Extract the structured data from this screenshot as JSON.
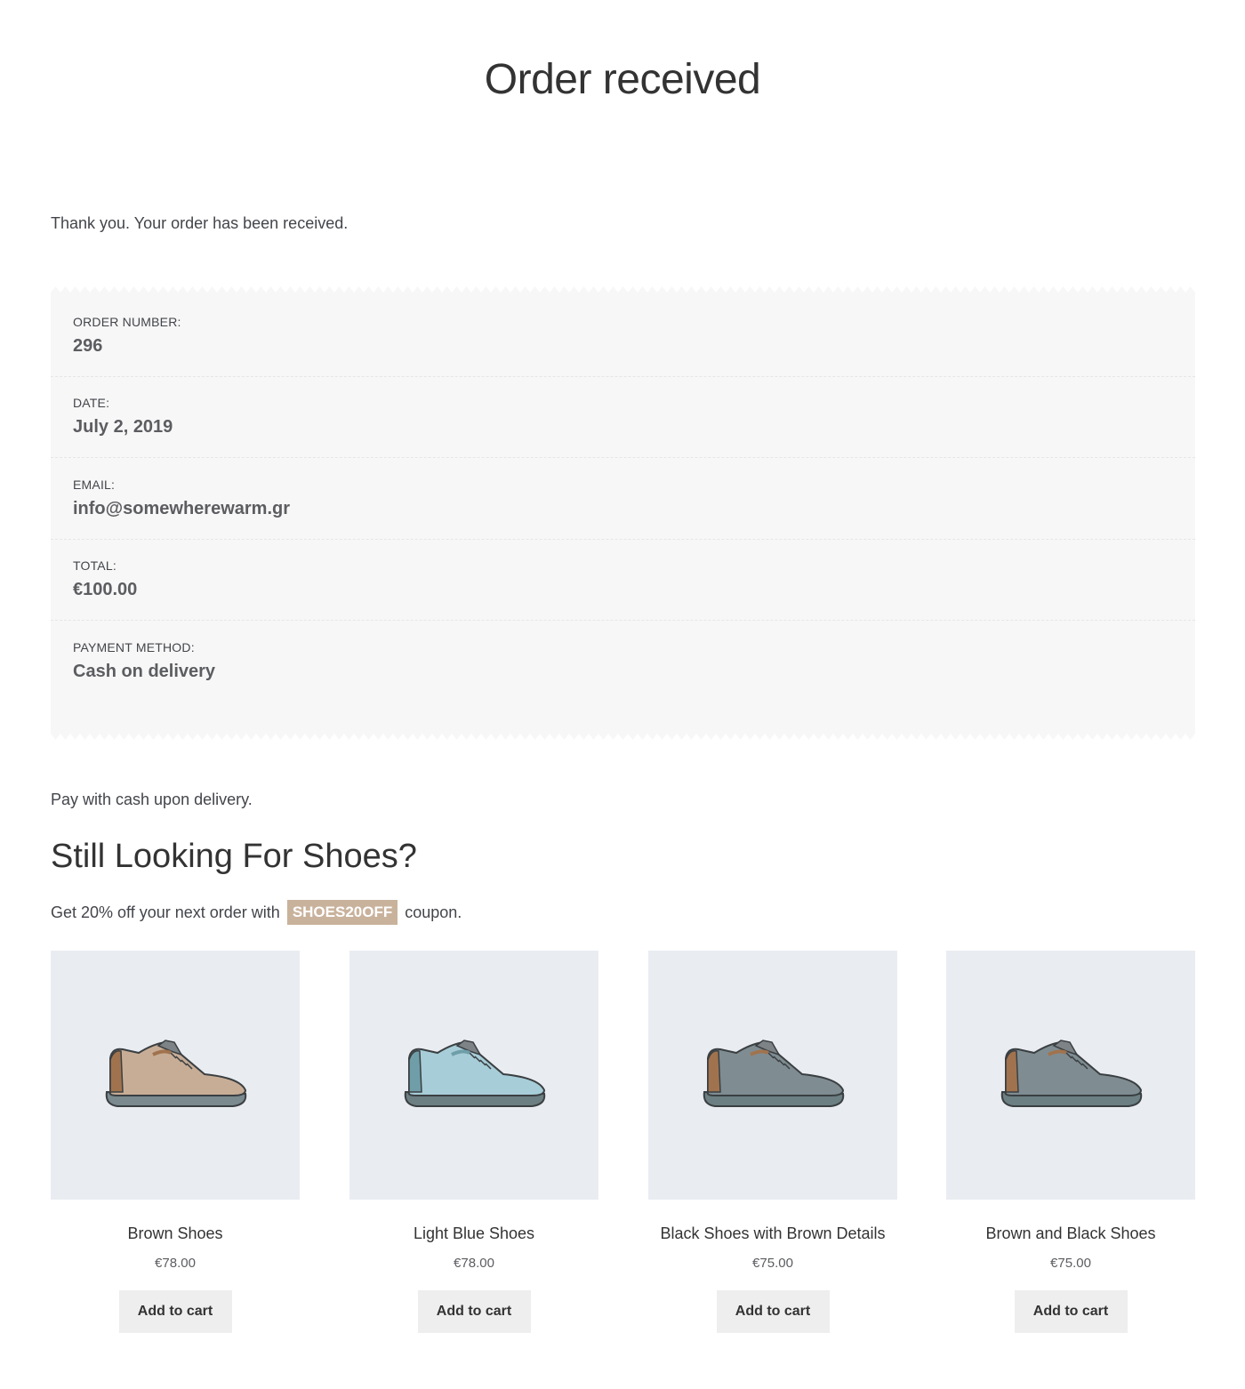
{
  "page": {
    "title": "Order received"
  },
  "thanks": "Thank you. Your order has been received.",
  "overview": [
    {
      "label": "ORDER NUMBER:",
      "value": "296"
    },
    {
      "label": "DATE:",
      "value": "July 2, 2019"
    },
    {
      "label": "EMAIL:",
      "value": "info@somewherewarm.gr"
    },
    {
      "label": "TOTAL:",
      "value": "€100.00"
    },
    {
      "label": "PAYMENT METHOD:",
      "value": "Cash on delivery"
    }
  ],
  "payment_note": "Pay with cash upon delivery.",
  "upsell": {
    "title": "Still Looking For Shoes?",
    "coupon_before": "Get 20% off your next order with",
    "coupon_code": "SHOES20OFF",
    "coupon_after": "coupon."
  },
  "products": [
    {
      "name": "Brown Shoes",
      "price": "€78.00",
      "button": "Add to cart",
      "icon": "sneaker-icon",
      "colors": {
        "upper": "#c8ad96",
        "heel": "#a0734e",
        "sole": "#7a8a8e"
      }
    },
    {
      "name": "Light Blue Shoes",
      "price": "€78.00",
      "button": "Add to cart",
      "icon": "sneaker-icon",
      "colors": {
        "upper": "#a7cdd8",
        "heel": "#6f9ea8",
        "sole": "#6c7f82"
      }
    },
    {
      "name": "Black Shoes with Brown Details",
      "price": "€75.00",
      "button": "Add to cart",
      "icon": "sneaker-icon",
      "colors": {
        "upper": "#7f8d92",
        "heel": "#a0734e",
        "sole": "#6c7f82"
      }
    },
    {
      "name": "Brown and Black Shoes",
      "price": "€75.00",
      "button": "Add to cart",
      "icon": "sneaker-icon",
      "colors": {
        "upper": "#7f8d92",
        "heel": "#a0734e",
        "sole": "#6c7f82"
      }
    }
  ],
  "colors": {
    "panel_bg": "#f7f7f7",
    "coupon_bg": "#c9b29c",
    "thumb_bg": "#e9ecf1",
    "button_bg": "#eeeeee"
  }
}
